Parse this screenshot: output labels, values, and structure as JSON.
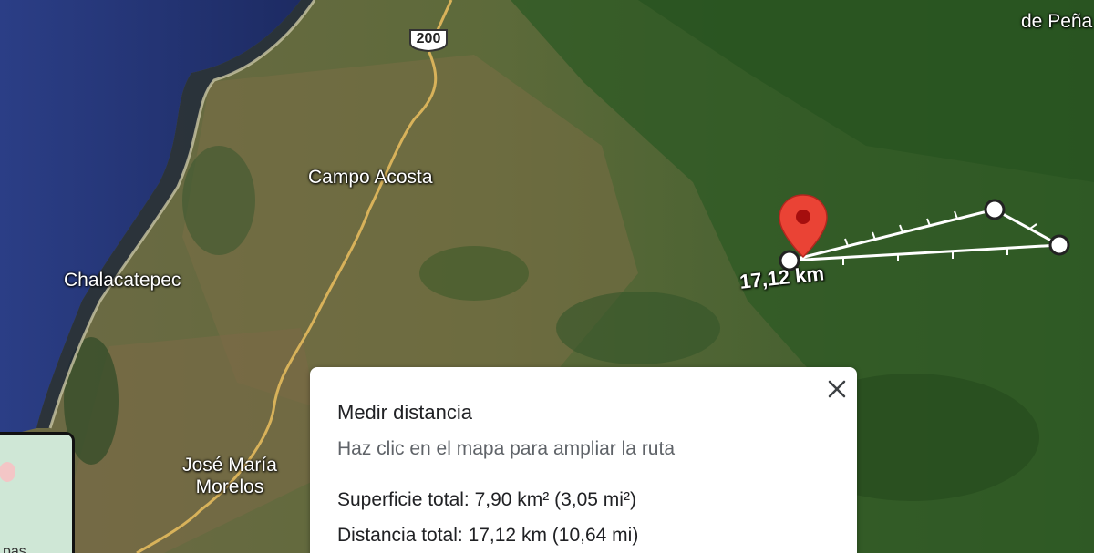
{
  "map": {
    "view": "satellite",
    "places": [
      {
        "id": "campo-acosta",
        "name": "Campo Acosta"
      },
      {
        "id": "chalacatepec",
        "name": "Chalacatepec"
      },
      {
        "id": "jose-maria-morelos",
        "name": "José María Morelos"
      },
      {
        "id": "de-pena",
        "name": "de Peña"
      }
    ],
    "highway": "200",
    "measurement_label": "17,12 km",
    "pin_color": "#ea4335",
    "route_color": "#ffffff"
  },
  "minimap": {
    "label": "pas"
  },
  "measure_panel": {
    "title": "Medir distancia",
    "hint": "Haz clic en el mapa para ampliar la ruta",
    "total_area": "Superficie total: 7,90 km² (3,05 mi²)",
    "total_distance": "Distancia total: 17,12 km (10,64 mi)",
    "close_icon": "close-icon"
  }
}
